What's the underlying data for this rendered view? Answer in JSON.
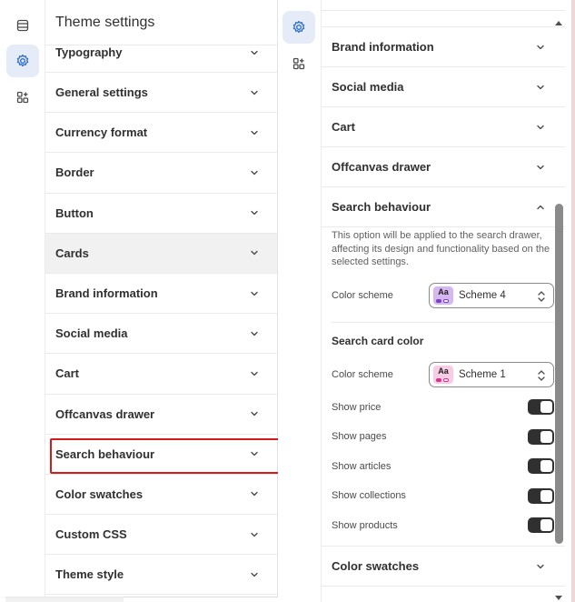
{
  "left": {
    "title": "Theme settings",
    "items": [
      {
        "label": "Typography"
      },
      {
        "label": "General settings"
      },
      {
        "label": "Currency format"
      },
      {
        "label": "Border"
      },
      {
        "label": "Button"
      },
      {
        "label": "Cards"
      },
      {
        "label": "Brand information"
      },
      {
        "label": "Social media"
      },
      {
        "label": "Cart"
      },
      {
        "label": "Offcanvas drawer"
      },
      {
        "label": "Search behaviour"
      },
      {
        "label": "Color swatches"
      },
      {
        "label": "Custom CSS"
      },
      {
        "label": "Theme style"
      }
    ]
  },
  "right": {
    "items_before": [
      {
        "label": "Brand information"
      },
      {
        "label": "Social media"
      },
      {
        "label": "Cart"
      },
      {
        "label": "Offcanvas drawer"
      }
    ],
    "search": {
      "label": "Search behaviour",
      "description": "This option will be applied to the search drawer, affecting its design and functionality based on the selected settings.",
      "color_scheme_label": "Color scheme",
      "color_scheme_value": "Scheme 4",
      "card_color_title": "Search card color",
      "card_scheme_label": "Color scheme",
      "card_scheme_value": "Scheme 1",
      "swatch_text": "Aa",
      "toggles": [
        {
          "label": "Show price",
          "on": true
        },
        {
          "label": "Show pages",
          "on": true
        },
        {
          "label": "Show articles",
          "on": true
        },
        {
          "label": "Show collections",
          "on": true
        },
        {
          "label": "Show products",
          "on": true
        }
      ]
    },
    "items_after": [
      {
        "label": "Color swatches"
      }
    ]
  },
  "colors": {
    "accent": "#d41b1b",
    "toggle_on": "#303030",
    "scheme4_bg": "#d6b8f0",
    "scheme1_bg": "#f7cde6"
  }
}
